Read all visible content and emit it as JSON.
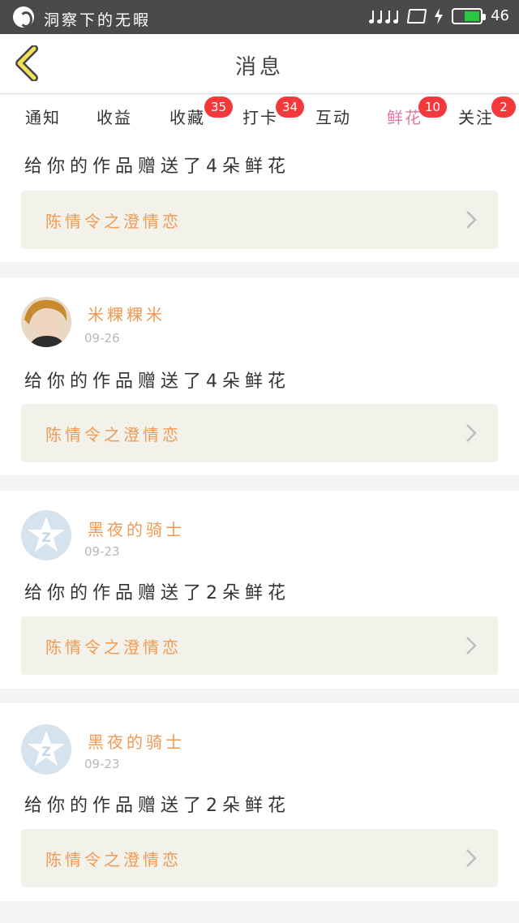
{
  "status_bar": {
    "app_name": "洞察下的无暇",
    "signal": "46"
  },
  "header": {
    "title": "消息"
  },
  "tabs": [
    {
      "label": "通知",
      "badge": ""
    },
    {
      "label": "收益",
      "badge": ""
    },
    {
      "label": "收藏",
      "badge": "35"
    },
    {
      "label": "打卡",
      "badge": "34"
    },
    {
      "label": "互动",
      "badge": ""
    },
    {
      "label": "鲜花",
      "badge": "10"
    },
    {
      "label": "关注",
      "badge": "2"
    }
  ],
  "colors": {
    "accent_pink": "#e07aa3",
    "orange": "#ef9a55",
    "badge_red": "#f23a3c"
  },
  "feed": [
    {
      "message": "给你的作品赠送了4朵鲜花",
      "work_title": "陈情令之澄情恋"
    },
    {
      "username": "米粿粿米",
      "date": "09-26",
      "avatar": "photo",
      "message": "给你的作品赠送了4朵鲜花",
      "work_title": "陈情令之澄情恋"
    },
    {
      "username": "黑夜的骑士",
      "date": "09-23",
      "avatar": "default-z-icon",
      "message": "给你的作品赠送了2朵鲜花",
      "work_title": "陈情令之澄情恋"
    },
    {
      "username": "黑夜的骑士",
      "date": "09-23",
      "avatar": "default-z-icon",
      "message": "给你的作品赠送了2朵鲜花",
      "work_title": "陈情令之澄情恋"
    }
  ]
}
